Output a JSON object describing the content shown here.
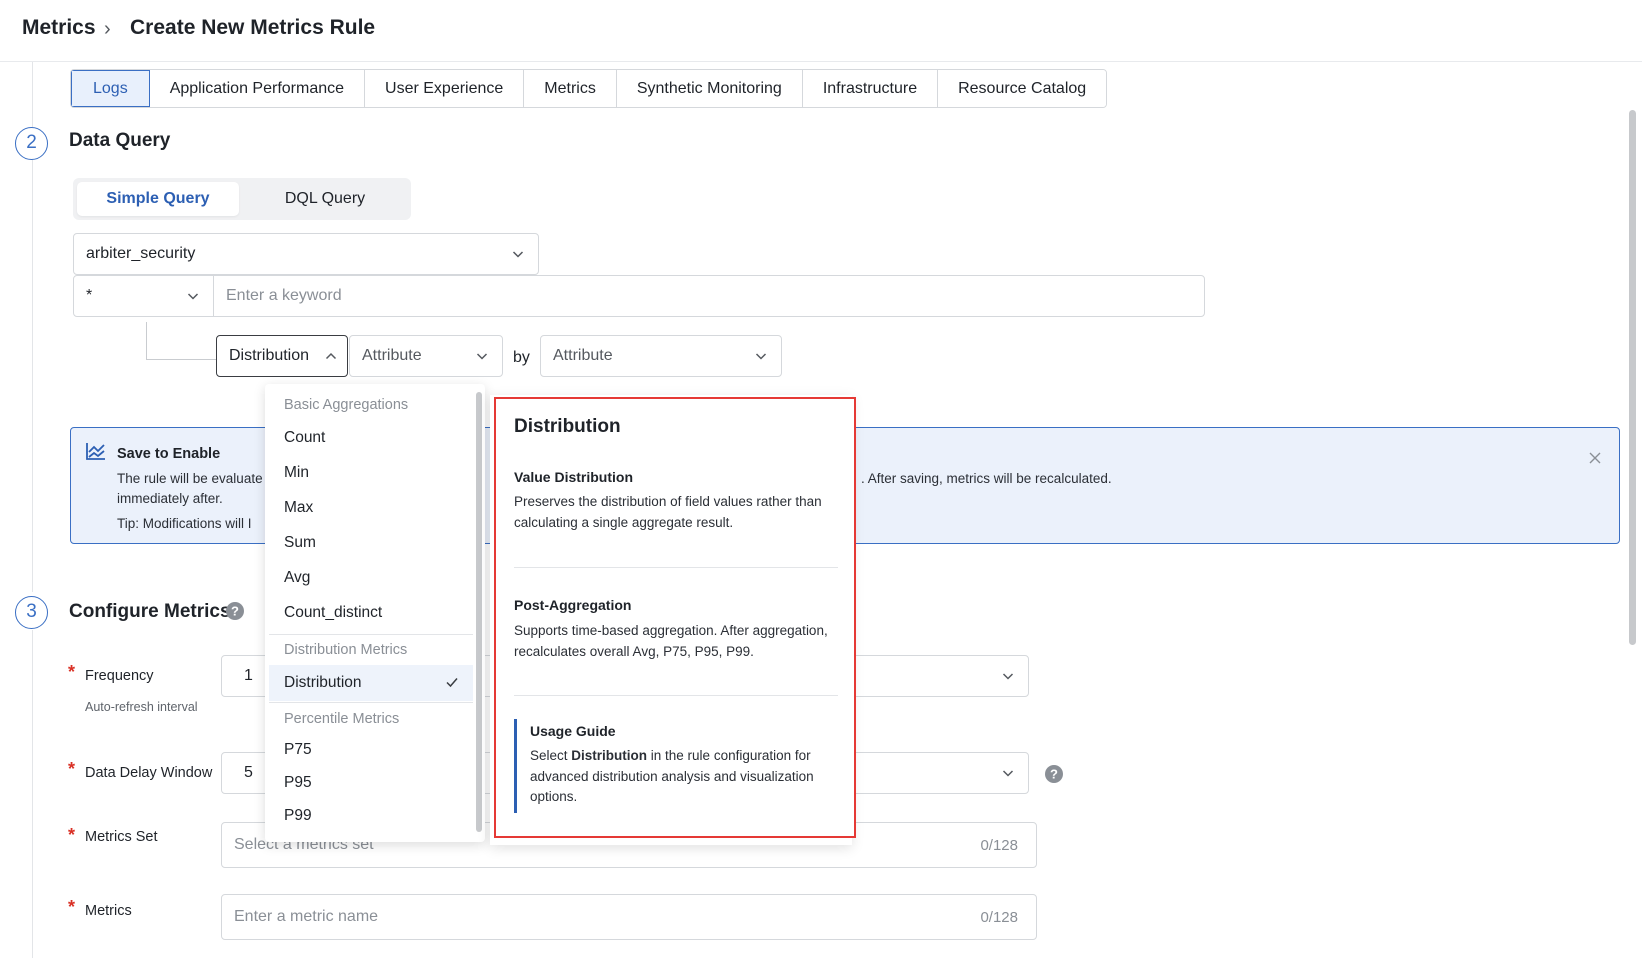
{
  "breadcrumb": {
    "root": "Metrics",
    "separator": "›",
    "current": "Create New Metrics Rule"
  },
  "source_tabs": [
    "Logs",
    "Application Performance",
    "User Experience",
    "Metrics",
    "Synthetic Monitoring",
    "Infrastructure",
    "Resource Catalog"
  ],
  "step2": {
    "number": "2",
    "title": "Data Query"
  },
  "query_mode": {
    "simple": "Simple Query",
    "dql": "DQL Query"
  },
  "index_select": {
    "value": "arbiter_security"
  },
  "filter": {
    "field_value": "*",
    "keyword_placeholder": "Enter a keyword"
  },
  "aggregation": {
    "function": "Distribution",
    "attribute": "Attribute",
    "by_label": "by",
    "group_by": "Attribute"
  },
  "dropdown": {
    "group_basic": "Basic Aggregations",
    "basic": [
      "Count",
      "Min",
      "Max",
      "Sum",
      "Avg",
      "Count_distinct"
    ],
    "group_distribution": "Distribution Metrics",
    "distribution": "Distribution",
    "group_percentile": "Percentile Metrics",
    "percentile": [
      "P75",
      "P95",
      "P99"
    ]
  },
  "tooltip": {
    "title": "Distribution",
    "value_title": "Value Distribution",
    "value_text": "Preserves the distribution of field values rather than calculating a single aggregate result.",
    "post_title": "Post-Aggregation",
    "post_text": "Supports time-based aggregation. After aggregation, recalculates overall Avg, P75, P95, P99.",
    "guide_title": "Usage Guide",
    "guide_pre": "Select ",
    "guide_bold": "Distribution",
    "guide_post": " in the rule configuration for advanced distribution analysis and visualization options."
  },
  "banner": {
    "title": "Save to Enable",
    "line1_left": "The rule will be evaluate",
    "line1_right": ". After saving, metrics will be recalculated.",
    "line2": "immediately after.",
    "tip": "Tip: Modifications will I"
  },
  "step3": {
    "number": "3",
    "title": "Configure Metrics"
  },
  "form": {
    "frequency_label": "Frequency",
    "frequency_help": "Auto-refresh interval",
    "frequency_value": "1",
    "delay_label": "Data Delay Window",
    "delay_value": "5",
    "metrics_set_label": "Metrics Set",
    "metrics_set_placeholder": "Select a metrics set",
    "metrics_set_counter": "0/128",
    "metrics_label": "Metrics",
    "metrics_placeholder": "Enter a metric name",
    "metrics_counter": "0/128"
  },
  "colors": {
    "accent": "#2c5fb3",
    "banner_bg": "#ebf1fb",
    "highlight_border": "#e53935",
    "required": "#d93025"
  },
  "icons": [
    "chevron-right-icon",
    "chevron-down-icon",
    "chevron-up-icon",
    "chart-trend-icon",
    "close-icon",
    "help-icon",
    "check-icon"
  ]
}
